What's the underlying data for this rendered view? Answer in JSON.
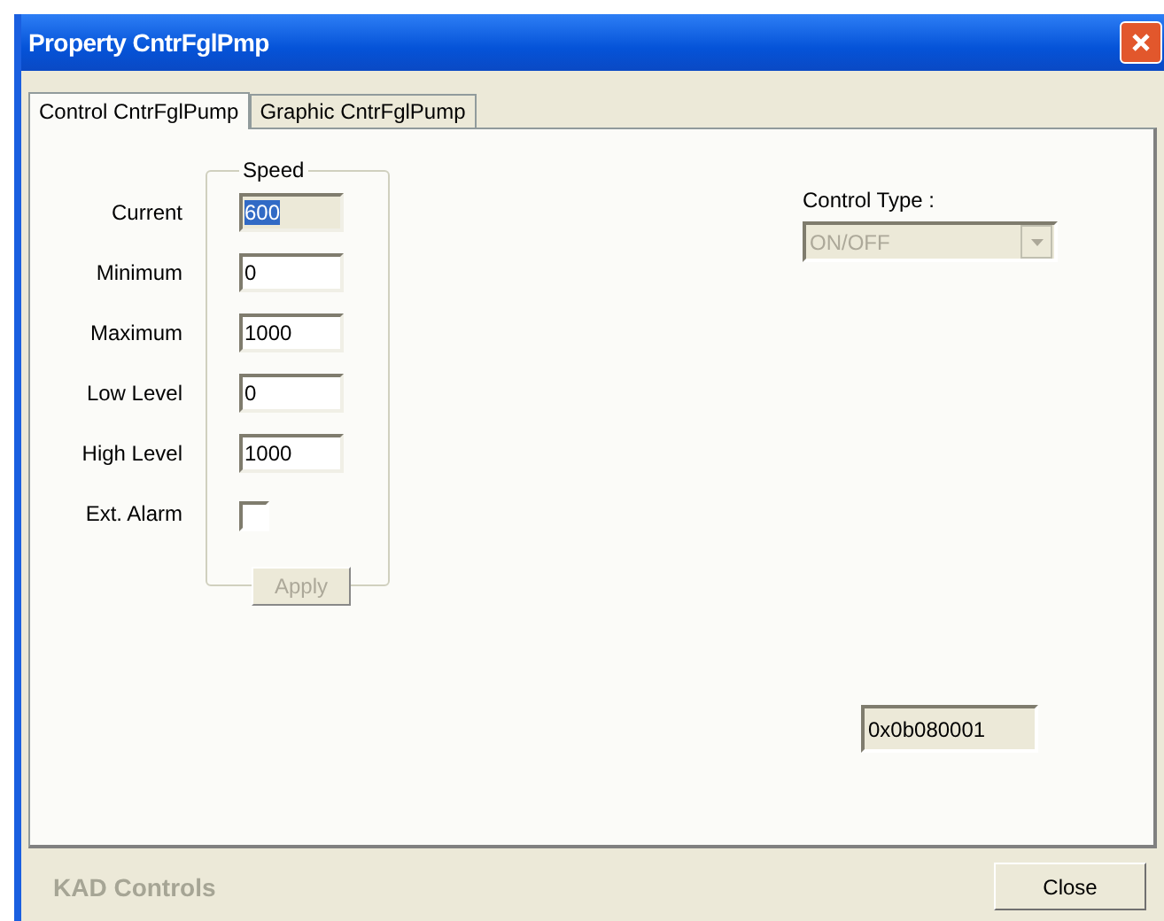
{
  "window": {
    "title": "Property CntrFglPmp"
  },
  "tabs": [
    {
      "label": "Control CntrFglPump",
      "selected": true
    },
    {
      "label": "Graphic CntrFglPump",
      "selected": false
    }
  ],
  "speed_group": {
    "title": "Speed",
    "fields": [
      {
        "label": "Current",
        "kind": "text",
        "value": "600",
        "disabled": true,
        "text_selected": true
      },
      {
        "label": "Minimum",
        "kind": "text",
        "value": "0",
        "disabled": false,
        "text_selected": false
      },
      {
        "label": "Maximum",
        "kind": "text",
        "value": "1000",
        "disabled": false,
        "text_selected": false
      },
      {
        "label": "Low Level",
        "kind": "text",
        "value": "0",
        "disabled": false,
        "text_selected": false
      },
      {
        "label": "High Level",
        "kind": "text",
        "value": "1000",
        "disabled": false,
        "text_selected": false
      },
      {
        "label": "Ext. Alarm",
        "kind": "checkbox",
        "checked": false
      }
    ],
    "apply_button": {
      "label": "Apply",
      "disabled": true
    }
  },
  "control_type": {
    "label": "Control Type :",
    "value": "ON/OFF",
    "disabled": true
  },
  "id_field": {
    "value": "0x0b080001"
  },
  "footer": {
    "brand": "KAD Controls",
    "close_button": {
      "label": "Close"
    }
  }
}
